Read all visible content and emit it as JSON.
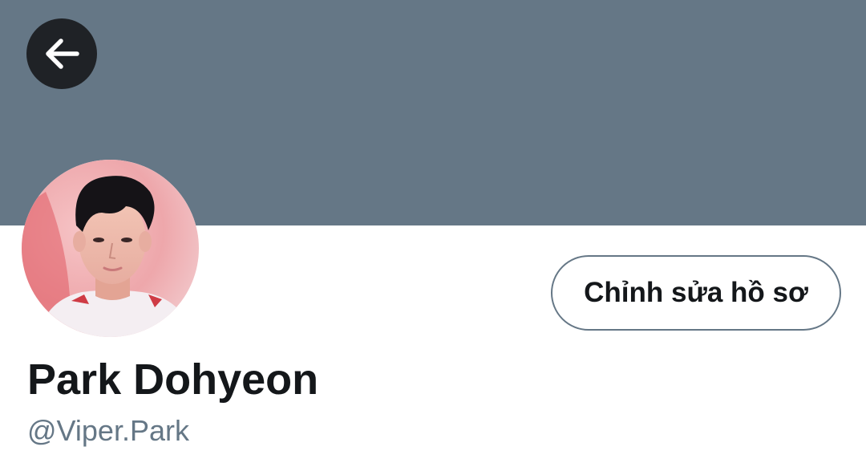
{
  "header": {
    "back_icon": "arrow-left-icon",
    "banner_color": "#657786"
  },
  "profile": {
    "avatar_alt": "Park Dohyeon",
    "edit_button_label": "Chỉnh sửa hồ sơ",
    "display_name": "Park Dohyeon",
    "handle": "@Viper.Park"
  },
  "colors": {
    "text_primary": "#14171a",
    "text_secondary": "#657786",
    "back_button_bg": "#1f2226"
  }
}
